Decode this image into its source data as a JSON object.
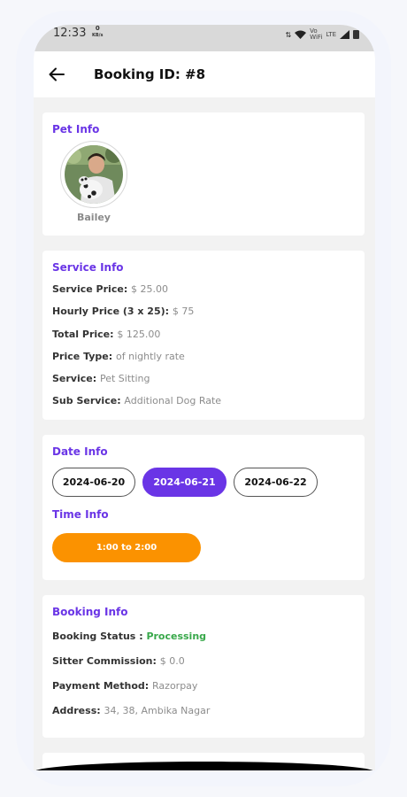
{
  "status_bar": {
    "time": "12:33",
    "speed_value": "0",
    "speed_unit": "KB/s",
    "network": "Vo\nWiFi",
    "lte": "LTE"
  },
  "header": {
    "title": "Booking ID: #8"
  },
  "pet_info": {
    "title": "Pet Info",
    "pet_name": "Bailey"
  },
  "service_info": {
    "title": "Service Info",
    "rows": [
      {
        "label": "Service Price",
        "value": "$ 25.00"
      },
      {
        "label": "Hourly Price (3 x 25)",
        "value": "$ 75"
      },
      {
        "label": "Total Price",
        "value": "$ 125.00"
      },
      {
        "label": "Price Type",
        "value": "of nightly rate"
      },
      {
        "label": "Service",
        "value": "Pet Sitting"
      },
      {
        "label": "Sub Service",
        "value": "Additional Dog Rate"
      }
    ]
  },
  "date_info": {
    "title": "Date Info",
    "dates": [
      "2024-06-20",
      "2024-06-21",
      "2024-06-22"
    ],
    "selected_date": "2024-06-21"
  },
  "time_info": {
    "title": "Time Info",
    "slot": "1:00 to 2:00"
  },
  "booking_info": {
    "title": "Booking Info",
    "rows": [
      {
        "label": "Booking Status ",
        "value": "Processing"
      },
      {
        "label": "Sitter Commission",
        "value": "$ 0.0"
      },
      {
        "label": "Payment Method",
        "value": "Razorpay"
      },
      {
        "label": "Address",
        "value": "34, 38, Ambika Nagar"
      }
    ]
  },
  "colors": {
    "accent": "#6a35e6",
    "time_slot": "#fb9200",
    "status_processing": "#38a84a"
  },
  "icons": {
    "back": "arrow-left-icon"
  }
}
